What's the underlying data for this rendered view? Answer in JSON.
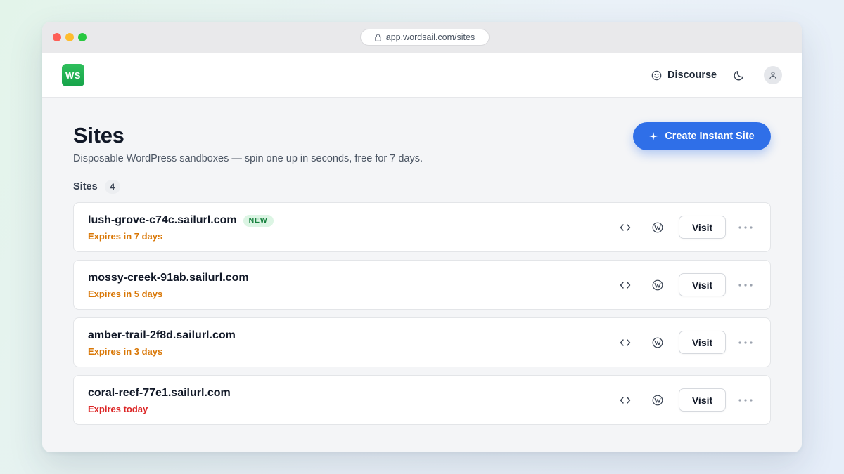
{
  "browser": {
    "url": "app.wordsail.com/sites",
    "lock_icon": "lock-icon"
  },
  "header": {
    "logo_text": "WS",
    "logo_color": "#22b14c",
    "discourse_label": "Discourse",
    "discourse_icon": "smiley-icon",
    "theme_icon": "moon-icon",
    "avatar_icon": "user-icon"
  },
  "page": {
    "title": "Sites",
    "subtitle": "Disposable WordPress sandboxes — spin one up in seconds, free for 7 days.",
    "create_button_label": "Create Instant Site",
    "create_button_icon": "sparkle-icon",
    "accent_color": "#2f6fe8"
  },
  "sites_section": {
    "label": "Sites",
    "count": "4"
  },
  "sites": [
    {
      "name": "lush-grove-c74c.sailurl.com",
      "badge": "NEW",
      "expires": "Expires in 7 days",
      "status": "warn",
      "visit_label": "Visit"
    },
    {
      "name": "mossy-creek-91ab.sailurl.com",
      "badge": "",
      "expires": "Expires in 5 days",
      "status": "warn",
      "visit_label": "Visit"
    },
    {
      "name": "amber-trail-2f8d.sailurl.com",
      "badge": "",
      "expires": "Expires in 3 days",
      "status": "warn",
      "visit_label": "Visit"
    },
    {
      "name": "coral-reef-77e1.sailurl.com",
      "badge": "",
      "expires": "Expires today",
      "status": "danger",
      "visit_label": "Visit"
    }
  ],
  "status_colors": {
    "warn": "#d97706",
    "danger": "#dc2626",
    "new_badge": "#15803d"
  }
}
